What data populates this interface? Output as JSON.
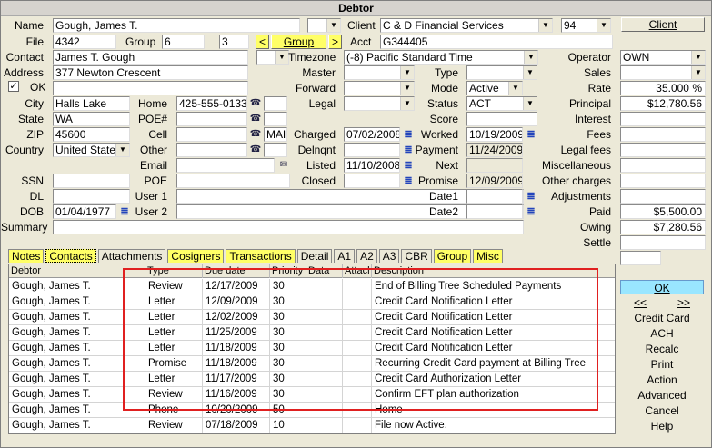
{
  "window": {
    "title": "Debtor"
  },
  "left": {
    "name_label": "Name",
    "name": "Gough, James T.",
    "file_label": "File",
    "file": "4342",
    "group_label": "Group",
    "group1": "6",
    "group2": "3",
    "group_btn": "Group",
    "contact_label": "Contact",
    "contact": "James T. Gough",
    "address_label": "Address",
    "address": "377 Newton Crescent",
    "ok_label": "OK",
    "city_label": "City",
    "city": "Halls Lake",
    "state_label": "State",
    "state": "WA",
    "zip_label": "ZIP",
    "zip": "45600",
    "country_label": "Country",
    "country": "United States",
    "ssn_label": "SSN",
    "dl_label": "DL",
    "dob_label": "DOB",
    "dob": "01/04/1977",
    "summary_label": "Summary"
  },
  "phones": {
    "home_label": "Home",
    "home": "425-555-0133",
    "poe_num_label": "POE#",
    "cell_label": "Cell",
    "cell_code": "MAH",
    "other_label": "Other",
    "email_label": "Email",
    "poe_label": "POE",
    "user1_label": "User 1",
    "user2_label": "User 2"
  },
  "mid": {
    "client_label": "Client",
    "client": "C & D Financial Services",
    "client_code": "94",
    "client_btn": "Client",
    "acct_label": "Acct",
    "acct": "G344405",
    "timezone_label": "Timezone",
    "timezone": "(-8) Pacific Standard Time",
    "master_label": "Master",
    "forward_label": "Forward",
    "legal_label": "Legal",
    "charged_label": "Charged",
    "charged": "07/02/2008",
    "delnqnt_label": "Delnqnt",
    "listed_label": "Listed",
    "listed": "11/10/2008",
    "closed_label": "Closed",
    "type_label": "Type",
    "mode_label": "Mode",
    "mode": "Active",
    "status_label": "Status",
    "status": "ACT",
    "score_label": "Score",
    "worked_label": "Worked",
    "worked": "10/19/2009",
    "payment_label": "Payment",
    "payment": "11/24/2009",
    "next_label": "Next",
    "promise_label": "Promise",
    "promise": "12/09/2009",
    "date1_label": "Date1",
    "date2_label": "Date2"
  },
  "right": {
    "operator_label": "Operator",
    "operator": "OWN",
    "sales_label": "Sales",
    "rate_label": "Rate",
    "rate": "35.000",
    "rate_unit": "%",
    "principal_label": "Principal",
    "principal": "$12,780.56",
    "interest_label": "Interest",
    "fees_label": "Fees",
    "legal_fees_label": "Legal fees",
    "misc_label": "Miscellaneous",
    "other_charges_label": "Other charges",
    "adjustments_label": "Adjustments",
    "paid_label": "Paid",
    "paid": "$5,500.00",
    "owing_label": "Owing",
    "owing": "$7,280.56",
    "settle_label": "Settle"
  },
  "tabs": [
    "Notes",
    "Contacts",
    "Attachments",
    "Cosigners",
    "Transactions",
    "Detail",
    "A1",
    "A2",
    "A3",
    "CBR",
    "Group",
    "Misc"
  ],
  "grid": {
    "headers": [
      "Debtor",
      "Type",
      "Due date",
      "Priority",
      "Data",
      "Attach",
      "Description"
    ],
    "rows": [
      [
        "Gough, James T.",
        "Review",
        "12/17/2009",
        "30",
        "",
        "",
        "End of Billing Tree Scheduled Payments"
      ],
      [
        "Gough, James T.",
        "Letter",
        "12/09/2009",
        "30",
        "",
        "",
        "Credit Card Notification Letter"
      ],
      [
        "Gough, James T.",
        "Letter",
        "12/02/2009",
        "30",
        "",
        "",
        "Credit Card Notification Letter"
      ],
      [
        "Gough, James T.",
        "Letter",
        "11/25/2009",
        "30",
        "",
        "",
        "Credit Card Notification Letter"
      ],
      [
        "Gough, James T.",
        "Letter",
        "11/18/2009",
        "30",
        "",
        "",
        "Credit Card Notification Letter"
      ],
      [
        "Gough, James T.",
        "Promise",
        "11/18/2009",
        "30",
        "",
        "",
        "Recurring Credit Card payment at Billing Tree"
      ],
      [
        "Gough, James T.",
        "Letter",
        "11/17/2009",
        "30",
        "",
        "",
        "Credit Card Authorization Letter"
      ],
      [
        "Gough, James T.",
        "Review",
        "11/16/2009",
        "30",
        "",
        "",
        "Confirm EFT plan authorization"
      ],
      [
        "Gough, James T.",
        "Phone",
        "10/20/2009",
        "50",
        "",
        "",
        "Home"
      ],
      [
        "Gough, James T.",
        "Review",
        "07/18/2009",
        "10",
        "",
        "",
        "File now Active."
      ]
    ]
  },
  "actions": {
    "ok": "OK",
    "prev": "<<",
    "next": ">>",
    "credit_card": "Credit Card",
    "ach": "ACH",
    "recalc": "Recalc",
    "print": "Print",
    "action": "Action",
    "advanced": "Advanced",
    "cancel": "Cancel",
    "help": "Help"
  },
  "colors": {
    "highlight": "#ffff66",
    "ok_button": "#99e6ff",
    "callout": "#e02020"
  }
}
